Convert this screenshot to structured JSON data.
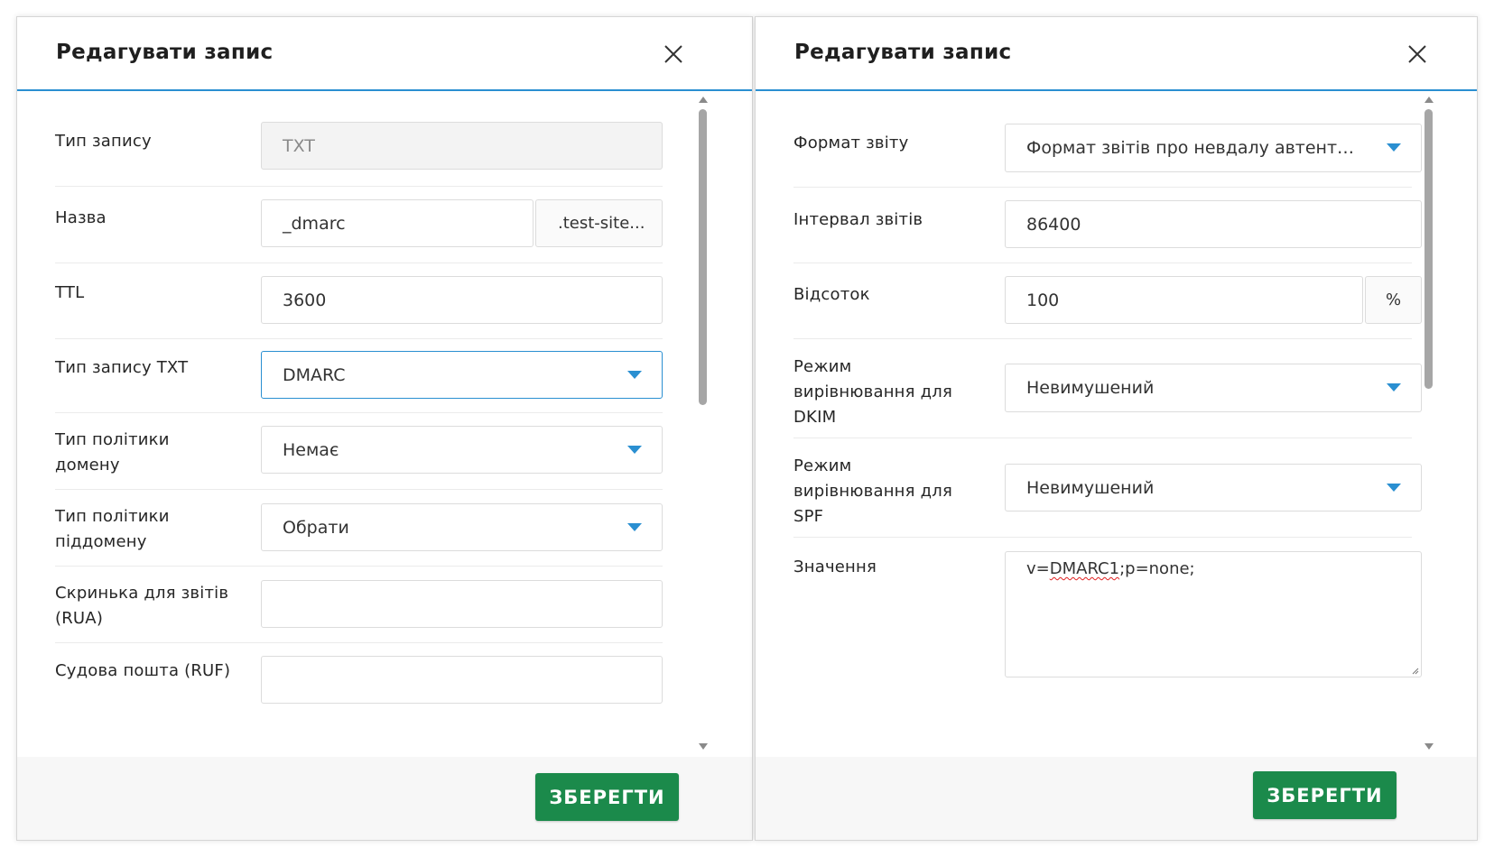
{
  "colors": {
    "accent": "#2a8fd1",
    "save_button": "#1b8a4b",
    "spellcheck": "#e02020"
  },
  "icons": {
    "close": "close-x-icon",
    "dropdown": "caret-down-icon"
  },
  "left_dialog": {
    "title": "Редагувати запис",
    "fields": {
      "record_type": {
        "label": "Тип запису",
        "value": "TXT"
      },
      "name": {
        "label": "Назва",
        "value": "_dmarc",
        "suffix": ".test-site..."
      },
      "ttl": {
        "label": "TTL",
        "value": "3600"
      },
      "txt_type": {
        "label": "Тип запису TXT",
        "value": "DMARC"
      },
      "domain_policy": {
        "label_line1": "Тип політики",
        "label_line2": "домену",
        "value": "Немає"
      },
      "subdomain_policy": {
        "label_line1": "Тип політики",
        "label_line2": "піддомену",
        "value": "Обрати"
      },
      "rua": {
        "label_line1": "Скринька для звітів",
        "label_line2": "(RUA)",
        "value": ""
      },
      "ruf": {
        "label": "Судова пошта (RUF)",
        "value": ""
      }
    },
    "save_label": "ЗБЕРЕГТИ"
  },
  "right_dialog": {
    "title": "Редагувати запис",
    "fields": {
      "report_format": {
        "label": "Формат звіту",
        "value": "Формат звітів про невдалу автенти..."
      },
      "report_interval": {
        "label": "Інтервал звітів",
        "value": "86400"
      },
      "percent": {
        "label": "Відсоток",
        "value": "100",
        "suffix": "%"
      },
      "dkim_alignment": {
        "label_line1": "Режим",
        "label_line2": "вирівнювання для",
        "label_line3": "DKIM",
        "value": "Невимушений"
      },
      "spf_alignment": {
        "label_line1": "Режим",
        "label_line2": "вирівнювання для",
        "label_line3": "SPF",
        "value": "Невимушений"
      },
      "value": {
        "label": "Значення",
        "text_prefix": "v=",
        "text_spell": "DMARC1",
        "text_suffix": ";p=none;"
      }
    },
    "save_label": "ЗБЕРЕГТИ"
  }
}
